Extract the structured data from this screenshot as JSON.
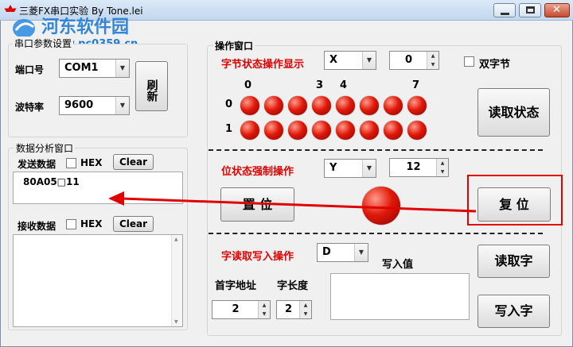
{
  "window": {
    "title": "三菱FX串口实验 By Tone.lei",
    "watermark_site": "河东软件园",
    "watermark_url": "www.pc0359.cn"
  },
  "serial": {
    "group_title": "串口参数设置",
    "port_label": "端口号",
    "port_value": "COM1",
    "baud_label": "波特率",
    "baud_value": "9600",
    "refresh_label": "刷新"
  },
  "analysis": {
    "group_title": "数据分析窗口",
    "send_label": "发送数据",
    "send_hex": "HEX",
    "send_clear": "Clear",
    "send_content": "80A05□11",
    "recv_label": "接收数据",
    "recv_hex": "HEX",
    "recv_clear": "Clear"
  },
  "ops": {
    "group_title": "操作窗口",
    "byte": {
      "title": "字节状态操作显示",
      "device": "X",
      "value": "0",
      "double_byte": "双字节",
      "bit_labels": [
        "0",
        "3",
        "4",
        "7"
      ],
      "row_labels": [
        "0",
        "1"
      ],
      "read_button": "读取状态"
    },
    "bit": {
      "title": "位状态强制操作",
      "device": "Y",
      "value": "12",
      "set_button": "置 位",
      "reset_button": "复 位"
    },
    "word": {
      "title": "字读取写入操作",
      "device": "D",
      "write_value_label": "写入值",
      "start_addr_label": "首字地址",
      "length_label": "字长度",
      "start_addr_value": "2",
      "length_value": "2",
      "read_button": "读取字",
      "write_button": "写入字"
    }
  },
  "colors": {
    "annotation_red": "#e00000",
    "label_red": "#e00000",
    "led_red": "#e11a0a"
  },
  "icons": {
    "app": "mitsubishi-logo-icon",
    "dropdown": "triangle-down",
    "spinner": "up-down-arrows"
  }
}
